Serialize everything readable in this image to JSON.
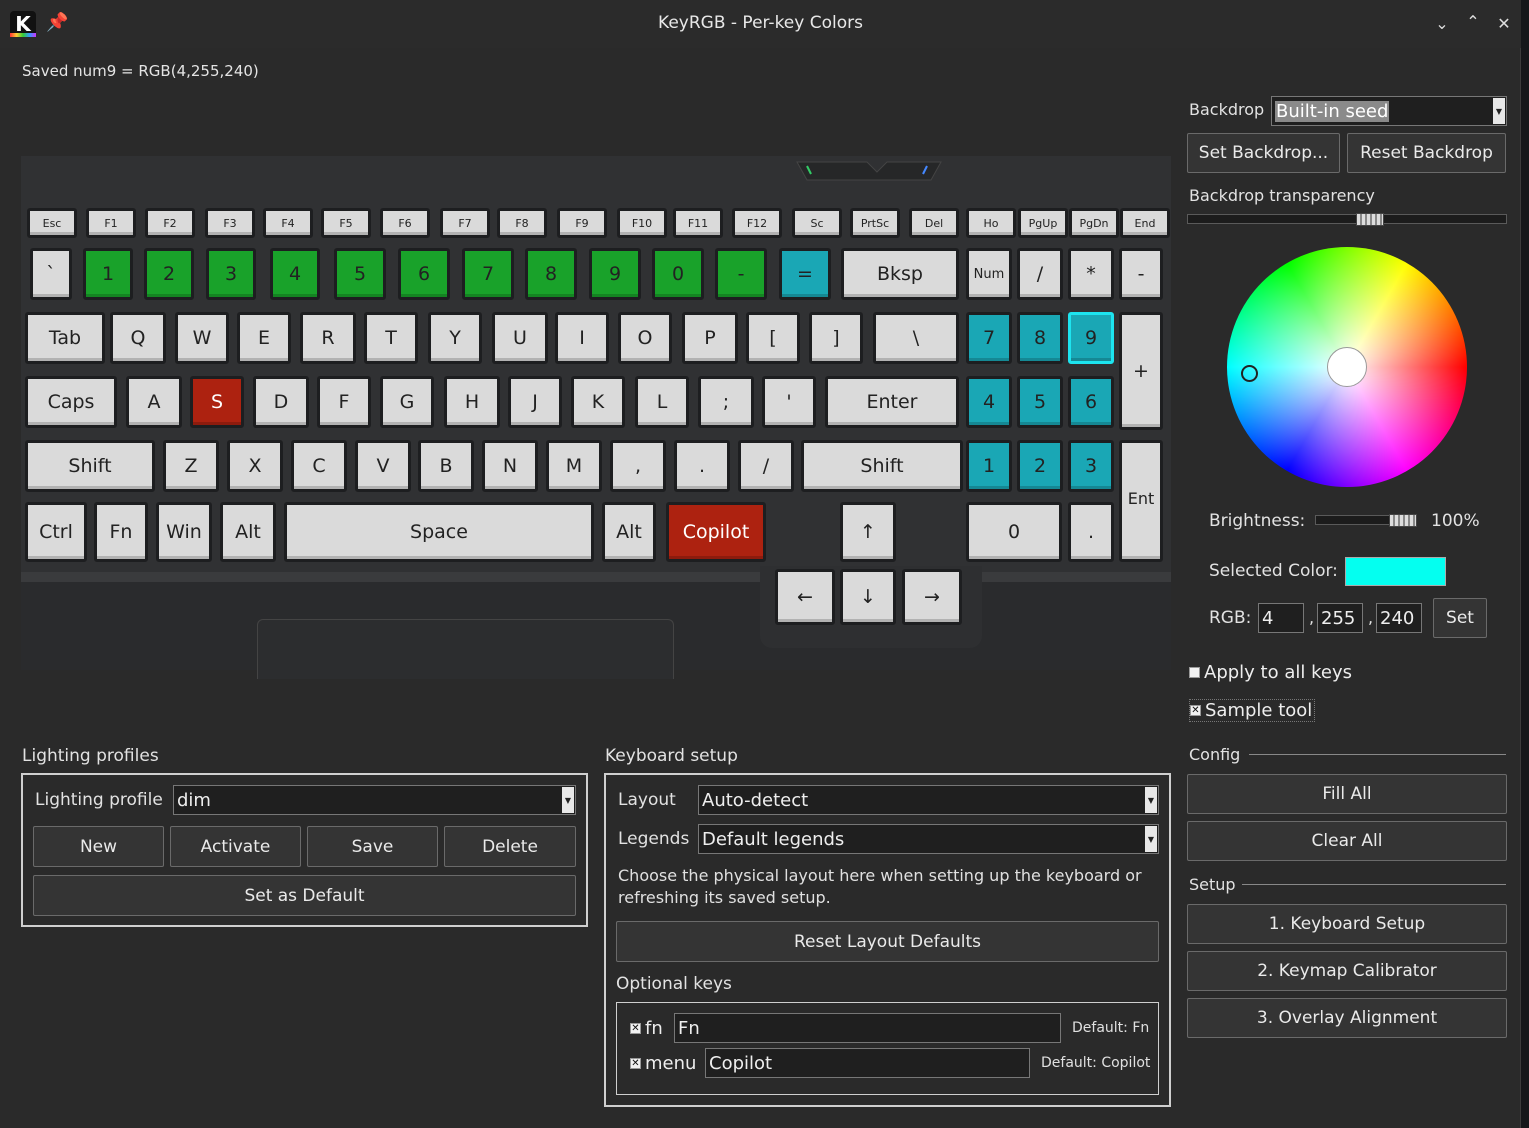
{
  "window": {
    "title": "KeyRGB - Per-key Colors",
    "app_icon": "K"
  },
  "status": "Saved num9 = RGB(4,255,240)",
  "keys": {
    "fn_row": [
      "Esc",
      "F1",
      "F2",
      "F3",
      "F4",
      "F5",
      "F6",
      "F7",
      "F8",
      "F9",
      "F10",
      "F11",
      "F12",
      "Sc",
      "PrtSc",
      "Del",
      "Ho",
      "PgUp",
      "PgDn",
      "End"
    ],
    "num_row": [
      "`",
      "1",
      "2",
      "3",
      "4",
      "5",
      "6",
      "7",
      "8",
      "9",
      "0",
      "-",
      "=",
      "Bksp",
      "Num",
      "/",
      "*",
      "-"
    ],
    "tab_row": [
      "Tab",
      "Q",
      "W",
      "E",
      "R",
      "T",
      "Y",
      "U",
      "I",
      "O",
      "P",
      "[",
      "]",
      "\\",
      "7",
      "8",
      "9",
      "+"
    ],
    "caps_row": [
      "Caps",
      "A",
      "S",
      "D",
      "F",
      "G",
      "H",
      "J",
      "K",
      "L",
      ";",
      "'",
      "Enter",
      "4",
      "5",
      "6"
    ],
    "shift_row": [
      "Shift",
      "Z",
      "X",
      "C",
      "V",
      "B",
      "N",
      "M",
      ",",
      ".",
      "/",
      "Shift",
      "1",
      "2",
      "3",
      "Ent"
    ],
    "bottom_row": [
      "Ctrl",
      "Fn",
      "Win",
      "Alt",
      "Space",
      "Alt",
      "Copilot",
      "↑",
      "0",
      "."
    ],
    "arrow_row": [
      "←",
      "↓",
      "→"
    ]
  },
  "backdrop": {
    "label": "Backdrop",
    "value": "Built-in seed",
    "set_button": "Set Backdrop...",
    "reset_button": "Reset Backdrop",
    "transparency_label": "Backdrop transparency",
    "transparency_level": 0.58
  },
  "color": {
    "brightness_label": "Brightness:",
    "brightness_value": "100%",
    "brightness_level": 1.0,
    "selected_label": "Selected Color:",
    "selected_hex": "#04fff0",
    "rgb_label": "RGB:",
    "r": "4",
    "g": "255",
    "b": "240",
    "sep1": ",",
    "sep2": ",",
    "set_button": "Set",
    "apply_all": "Apply to all keys",
    "sample_tool": "Sample tool"
  },
  "config": {
    "heading": "Config",
    "fill_all": "Fill All",
    "clear_all": "Clear All"
  },
  "setup": {
    "heading": "Setup",
    "step1": "1. Keyboard Setup",
    "step2": "2. Keymap Calibrator",
    "step3": "3. Overlay Alignment"
  },
  "profiles": {
    "heading": "Lighting profiles",
    "profile_label": "Lighting profile",
    "profile_value": "dim",
    "new": "New",
    "activate": "Activate",
    "save": "Save",
    "delete": "Delete",
    "set_default": "Set as Default"
  },
  "kbsetup": {
    "heading": "Keyboard setup",
    "layout_label": "Layout",
    "layout_value": "Auto-detect",
    "legends_label": "Legends",
    "legends_value": "Default legends",
    "hint_line1": "Choose the physical layout here when setting up the keyboard or",
    "hint_line2": "refreshing its saved setup.",
    "reset_button": "Reset Layout Defaults",
    "optional_heading": "Optional keys",
    "fn_label": "fn",
    "fn_value": "Fn",
    "fn_default": "Default: Fn",
    "menu_label": "menu",
    "menu_value": "Copilot",
    "menu_default": "Default: Copilot"
  }
}
